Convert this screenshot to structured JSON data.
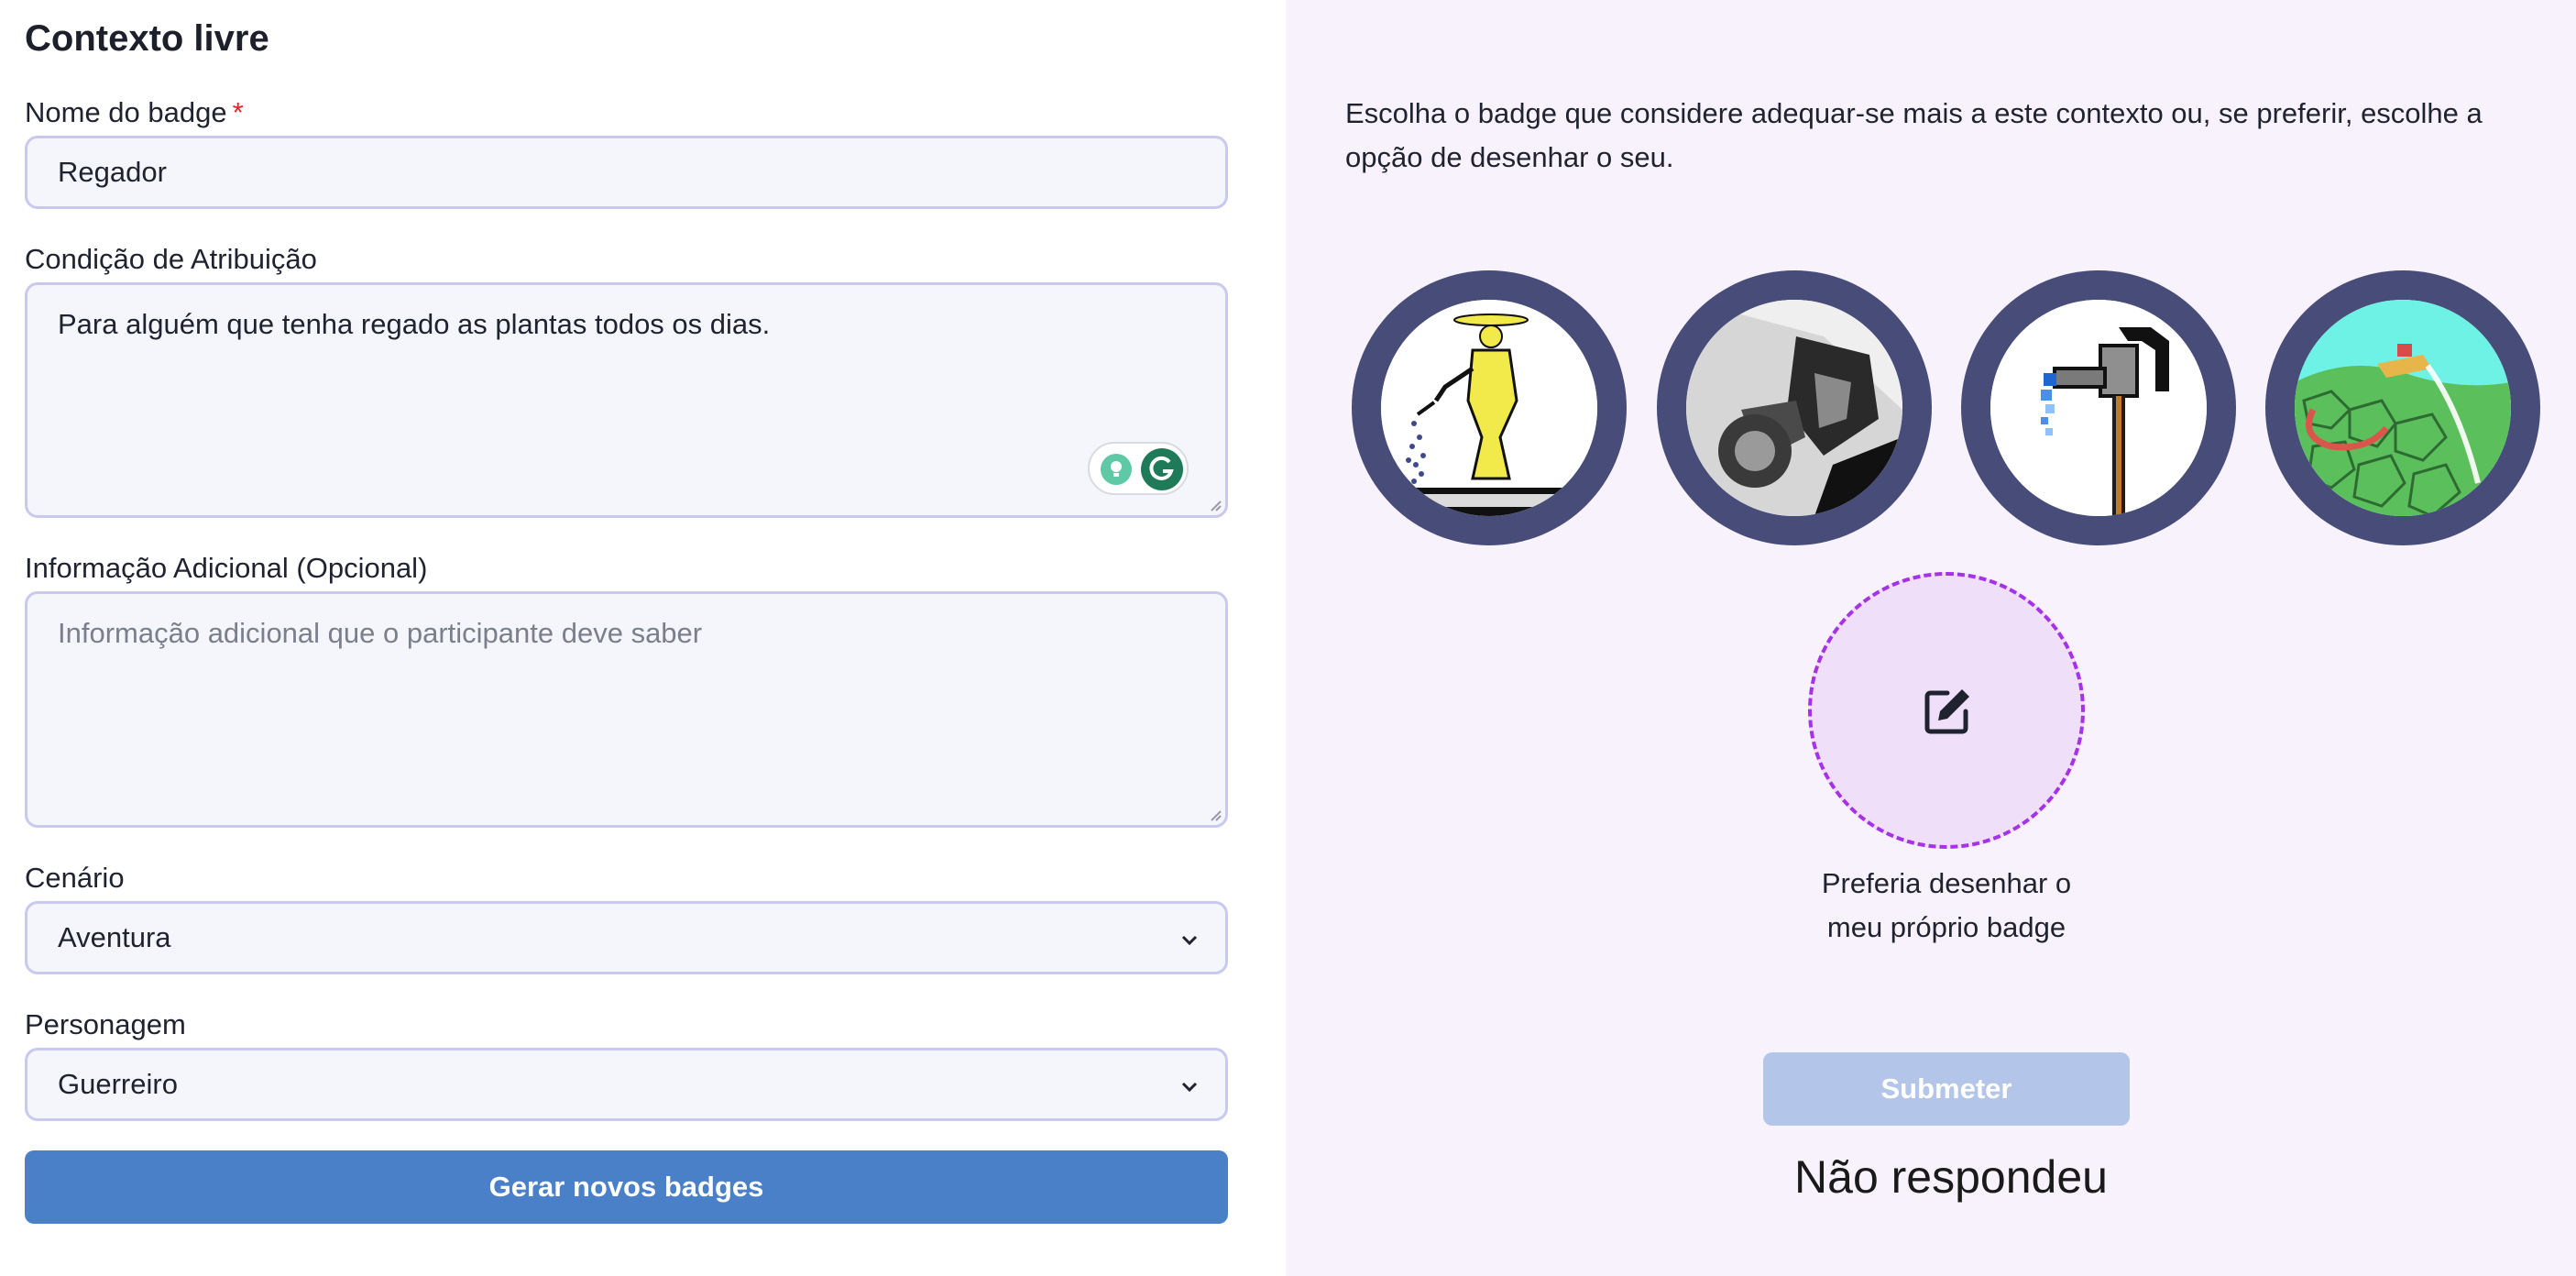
{
  "form": {
    "title": "Contexto livre",
    "badge_name": {
      "label": "Nome do badge",
      "required_mark": "*",
      "value": "Regador"
    },
    "condition": {
      "label": "Condição de Atribuição",
      "value": "Para alguém que tenha regado as plantas todos os dias."
    },
    "additional_info": {
      "label": "Informação Adicional (Opcional)",
      "value": "",
      "placeholder": "Informação adicional que o participante deve saber"
    },
    "scenario": {
      "label": "Cenário",
      "selected": "Aventura"
    },
    "character": {
      "label": "Personagem",
      "selected": "Guerreiro"
    },
    "generate_button": "Gerar novos badges"
  },
  "badges_panel": {
    "intro": "Escolha o badge que considere adequar-se mais a este contexto ou, se preferir, escolhe a opção de desenhar o seu.",
    "badges": [
      {
        "icon": "watering-woman-icon"
      },
      {
        "icon": "faucet-closeup-icon"
      },
      {
        "icon": "pixel-faucet-icon"
      },
      {
        "icon": "garden-hose-icon"
      }
    ],
    "draw_own": {
      "icon": "edit-icon",
      "label": "Preferia desenhar o meu próprio badge"
    },
    "submit_button": "Submeter",
    "status": "Não respondeu"
  },
  "colors": {
    "primary": "#4a80c8",
    "submit_disabled": "#b3c5e9",
    "badge_ring": "#474c78",
    "panel_bg": "#f8f2fc",
    "draw_border": "#a531e8",
    "draw_bg": "#efdff8",
    "required": "#e02424"
  }
}
